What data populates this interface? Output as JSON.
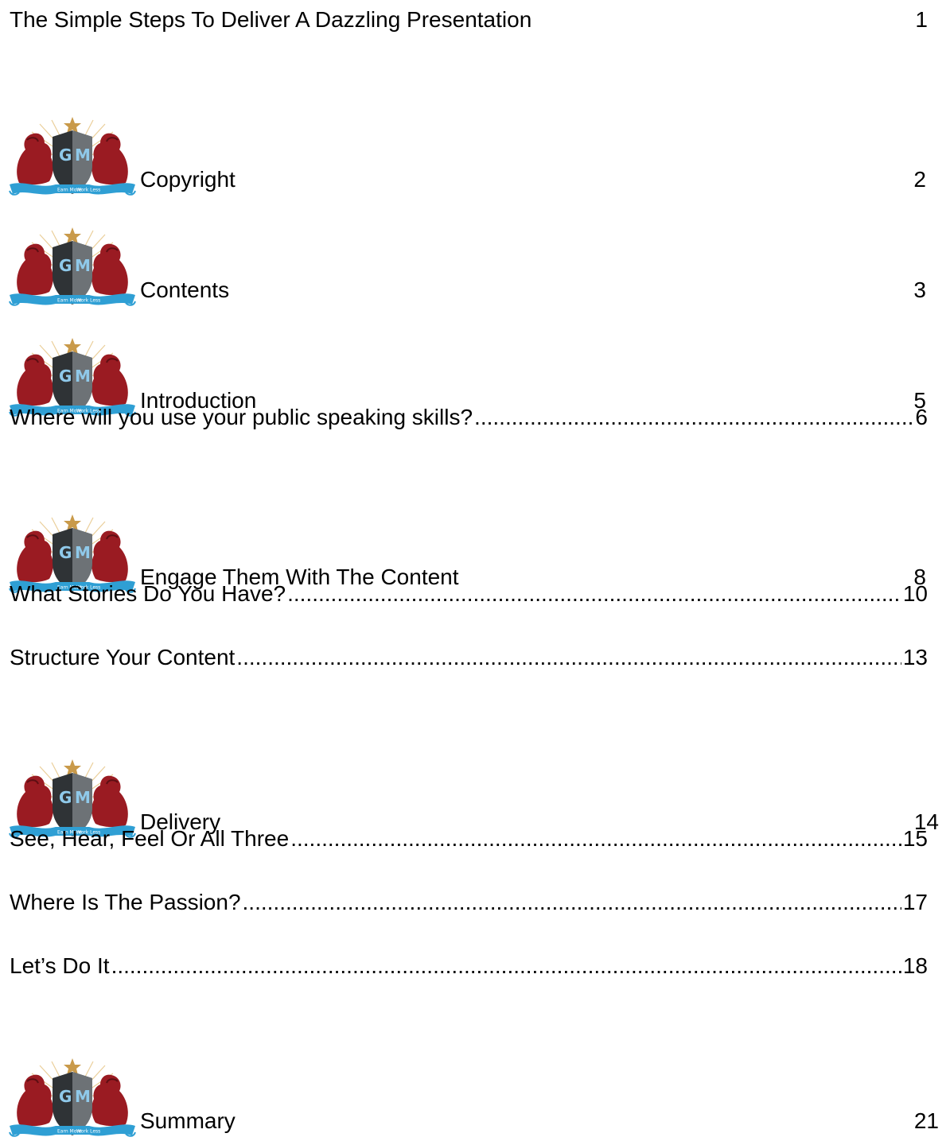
{
  "toc": {
    "entries": [
      {
        "title": "The Simple Steps To Deliver A Dazzling Presentation",
        "page": "1"
      },
      {
        "title": "Copyright",
        "page": "2"
      },
      {
        "title": "Contents",
        "page": "3"
      },
      {
        "title": "Introduction",
        "page": "5"
      },
      {
        "title": "Where will you use your public speaking skills?",
        "page": "6"
      },
      {
        "title": "Engage Them With The Content",
        "page": "8"
      },
      {
        "title": "What Stories Do You Have?",
        "page": "10"
      },
      {
        "title": "Structure Your Content",
        "page": "13"
      },
      {
        "title": "Delivery",
        "page": "14"
      },
      {
        "title": "See, Hear, Feel Or All Three",
        "page": "15"
      },
      {
        "title": "Where Is The Passion?",
        "page": "17"
      },
      {
        "title": "Let’s Do It",
        "page": "18"
      },
      {
        "title": "Summary",
        "page": "21"
      }
    ]
  },
  "logo": {
    "initials": "GM",
    "ribbon_left": "Earn More",
    "ribbon_right": "Work Less",
    "colors": {
      "lion": "#9a1b22",
      "shield_dark": "#2f3336",
      "shield_light": "#6d7276",
      "letters": "#8fc9ea",
      "ribbon": "#2f9fd4",
      "star": "#c99a4a",
      "rays": "#e8c98e"
    }
  }
}
